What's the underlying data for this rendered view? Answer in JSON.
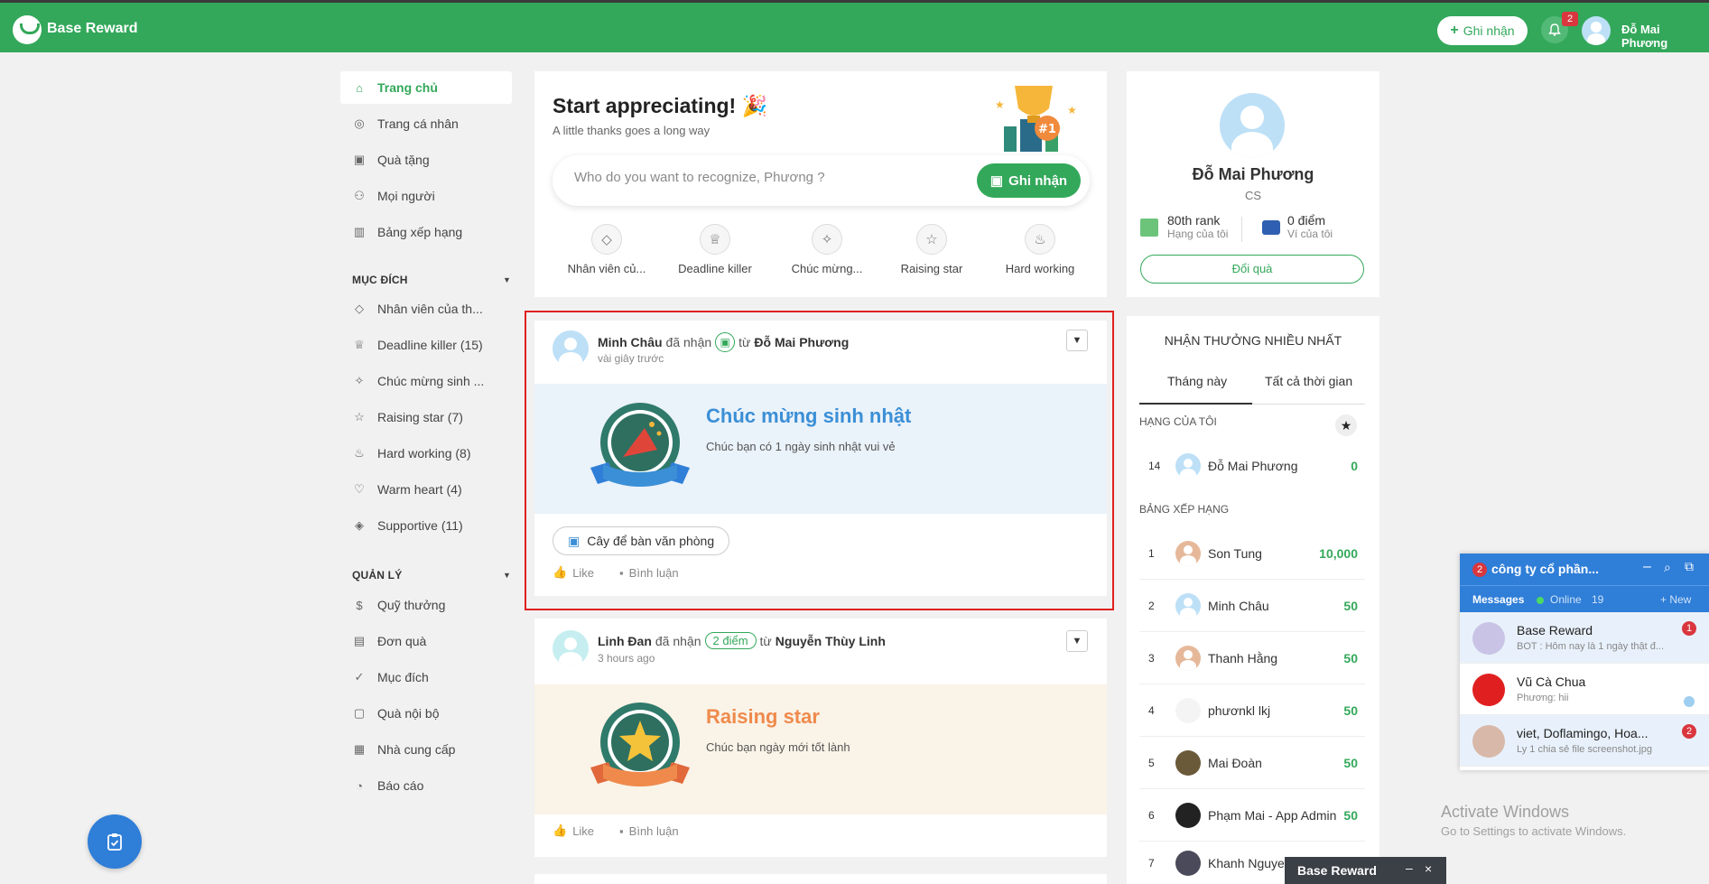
{
  "app": {
    "brand": "Base Reward"
  },
  "header": {
    "recognize_button": "Ghi nhận",
    "notification_count": "2",
    "user_name": "Đỗ Mai Phương"
  },
  "sidebar": {
    "items": [
      {
        "label": "Trang chủ",
        "icon": "home-icon"
      },
      {
        "label": "Trang cá nhân",
        "icon": "user-circle-icon"
      },
      {
        "label": "Quà tặng",
        "icon": "gift-icon"
      },
      {
        "label": "Mọi người",
        "icon": "people-icon"
      },
      {
        "label": "Bảng xếp hạng",
        "icon": "chart-icon"
      }
    ],
    "purpose_title": "MỤC ĐÍCH",
    "purposes": [
      {
        "label": "Nhân viên của th...",
        "icon": "diamond-icon"
      },
      {
        "label": "Deadline killer (15)",
        "icon": "trophy-icon"
      },
      {
        "label": "Chúc mừng sinh ...",
        "icon": "party-icon"
      },
      {
        "label": "Raising star (7)",
        "icon": "star-icon"
      },
      {
        "label": "Hard working (8)",
        "icon": "fire-icon"
      },
      {
        "label": "Warm heart (4)",
        "icon": "heart-icon"
      },
      {
        "label": "Supportive (11)",
        "icon": "handshake-icon"
      }
    ],
    "manage_title": "QUẢN LÝ",
    "manage": [
      {
        "label": "Quỹ thưởng",
        "icon": "money-bag-icon"
      },
      {
        "label": "Đơn quà",
        "icon": "order-icon"
      },
      {
        "label": "Mục đích",
        "icon": "check-circle-icon"
      },
      {
        "label": "Quà nội bộ",
        "icon": "box-icon"
      },
      {
        "label": "Nhà cung cấp",
        "icon": "store-icon"
      },
      {
        "label": "Báo cáo",
        "icon": "report-icon"
      }
    ]
  },
  "appreciate": {
    "title": "Start appreciating! 🎉",
    "subtitle": "A little thanks goes a long way",
    "placeholder": "Who do you want to recognize, Phương ?",
    "button": "Ghi nhận",
    "categories": [
      "Nhân viên củ...",
      "Deadline killer",
      "Chúc mừng...",
      "Raising star",
      "Hard working"
    ]
  },
  "posts": [
    {
      "receiver": "Minh Châu",
      "verb": "đã nhận",
      "from_word": "từ",
      "sender": "Đỗ Mai Phương",
      "time": "vài giây trước",
      "title": "Chúc mừng sinh nhật",
      "message": "Chúc bạn có 1 ngày sinh nhật vui vẻ",
      "gift": "Cây để bàn văn phòng",
      "like": "Like",
      "comment": "Bình luận",
      "title_color": "#3b8fd6",
      "bg_color": "#eaf2fa"
    },
    {
      "receiver": "Linh Đan",
      "verb": "đã nhận",
      "points": "2 điểm",
      "from_word": "từ",
      "sender": "Nguyễn Thùy Linh",
      "time": "3 hours ago",
      "title": "Raising star",
      "message": "Chúc bạn ngày mới tốt lành",
      "like": "Like",
      "comment": "Bình luận",
      "title_color": "#ef8a4c",
      "bg_color": "#faf3e7"
    }
  ],
  "profile": {
    "name": "Đỗ Mai Phương",
    "role": "CS",
    "rank": "80th rank",
    "rank_label": "Hạng của tôi",
    "points": "0 điểm",
    "points_label": "Ví của tôi",
    "redeem": "Đổi quà"
  },
  "leaderboard": {
    "title": "NHẬN THƯỞNG NHIỀU NHẤT",
    "tabs": [
      "Tháng này",
      "Tất cả thời gian"
    ],
    "my_rank_label": "HẠNG CỦA TÔI",
    "my_rank": {
      "rank": "14",
      "name": "Đỗ Mai Phương",
      "points": "0"
    },
    "board_label": "BẢNG XẾP HẠNG",
    "rows": [
      {
        "rank": "1",
        "name": "Son Tung",
        "points": "10,000"
      },
      {
        "rank": "2",
        "name": "Minh Châu",
        "points": "50"
      },
      {
        "rank": "3",
        "name": "Thanh Hằng",
        "points": "50"
      },
      {
        "rank": "4",
        "name": "phươnkl lkj",
        "points": "50"
      },
      {
        "rank": "5",
        "name": "Mai Đoàn",
        "points": "50"
      },
      {
        "rank": "6",
        "name": "Phạm Mai - App Admin",
        "points": "50"
      },
      {
        "rank": "7",
        "name": "Khanh Nguyen",
        "points": ""
      }
    ]
  },
  "chat": {
    "badge": "2",
    "company": "công ty cổ phần...",
    "messages_label": "Messages",
    "online_label": "Online",
    "online_count": "19",
    "new_label": "+ New",
    "items": [
      {
        "name": "Base Reward",
        "msg": "BOT : Hôm nay là 1 ngày thật đ...",
        "badge": "1"
      },
      {
        "name": "Vũ Cà Chua",
        "msg": "Phương: hii",
        "badge": ""
      },
      {
        "name": "viet, Doflamingo, Hoa...",
        "msg": "Ly 1 chia sẻ file screenshot.jpg",
        "badge": "2"
      }
    ]
  },
  "bottom_chat": {
    "title": "Base Reward"
  },
  "windows": {
    "activate_title": "Activate Windows",
    "activate_sub": "Go to Settings to activate Windows."
  }
}
